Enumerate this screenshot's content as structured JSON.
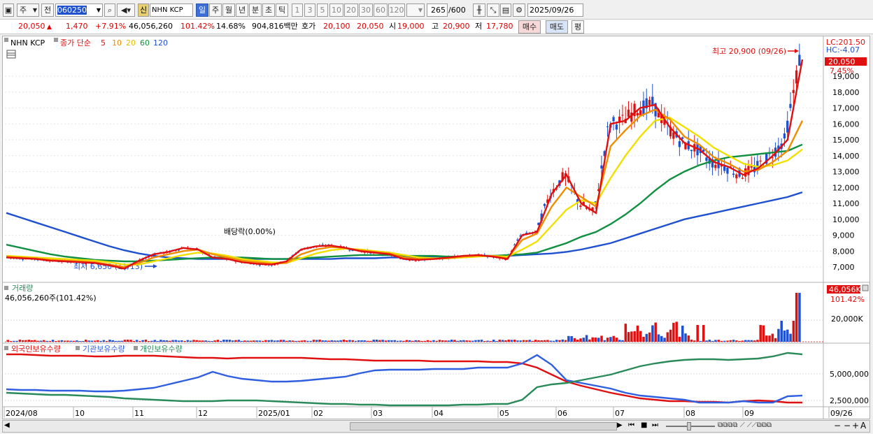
{
  "toolbar": {
    "market_type": "주",
    "prev_label": "전",
    "stock_code": "060250",
    "new_badge": "신",
    "stock_name": "NHN KCP",
    "periods": [
      "일",
      "주",
      "월",
      "년",
      "분",
      "초",
      "틱"
    ],
    "active_period": "일",
    "intervals": [
      "1",
      "3",
      "5",
      "10",
      "20",
      "30",
      "60",
      "120"
    ],
    "count_value": "265",
    "count_total": "/600",
    "date": "2025/09/26"
  },
  "quote": {
    "price": "20,050",
    "arrow": "▲",
    "change": "1,470",
    "change_pct": "+7.91%",
    "volume": "46,056,260",
    "volume_ratio": "101.42%",
    "turnover": "14.68%",
    "amount": "904,816백만",
    "bid_label": "호가",
    "bid1": "20,100",
    "bid2": "20,050",
    "open_label": "시",
    "open": "19,000",
    "high_label": "고",
    "high": "20,900",
    "low_label": "저",
    "low": "17,780",
    "buy_label": "매수",
    "sell_label": "매도",
    "eval_label": "평"
  },
  "price_panel": {
    "legend_name": "NHN KCP",
    "legend_ma_label": "종가 단순",
    "ma_periods": [
      "5",
      "10",
      "20",
      "60",
      "120"
    ],
    "ma_colors": [
      "#e01010",
      "#f08c00",
      "#f0e000",
      "#109040",
      "#1e50d0"
    ],
    "lc_label": "LC:201.50",
    "hc_label": "HC:-4.07",
    "current_price_badge": "20,050",
    "current_pct_badge": "7.45%",
    "high_marker": "최고 20,900 (09/26)",
    "low_marker": "최저 6,650 (11/13)",
    "dividend_marker": "배당락(0.00%)"
  },
  "volume_panel": {
    "title": "거래량",
    "value_text": "46,056,260주(101.42%)",
    "badge_value": "46,056K",
    "badge_pct": "101.42%"
  },
  "holdings_panel": {
    "legend": [
      "외국인보유수량",
      "기관보유수량",
      "개인보유수량"
    ],
    "colors": [
      "#e01010",
      "#2f5fe0",
      "#2a8a5a"
    ]
  },
  "x_labels": [
    "2024/08",
    "10",
    "11",
    "12",
    "2025/01",
    "02",
    "03",
    "04",
    "05",
    "06",
    "07",
    "08",
    "09",
    "09/26"
  ],
  "chart_data": {
    "type": "line",
    "price_axis": {
      "ticks": [
        "19,000",
        "18,000",
        "17,000",
        "16,000",
        "15,000",
        "14,000",
        "13,000",
        "12,000",
        "11,000",
        "10,000",
        "9,000",
        "8,000",
        "7,000"
      ],
      "ylim": [
        6000,
        21000
      ]
    },
    "volume_axis": {
      "ticks": [
        "20,000K"
      ]
    },
    "holdings_axis": {
      "ticks": [
        "5,000,000",
        "2,500,000"
      ]
    },
    "series": [
      {
        "name": "5",
        "values": [
          7600,
          7550,
          7500,
          7400,
          7350,
          7300,
          7250,
          7100,
          6900,
          7400,
          7800,
          7950,
          8200,
          8100,
          7600,
          7500,
          7300,
          7200,
          7150,
          7350,
          8100,
          8300,
          8350,
          8200,
          8000,
          7900,
          7800,
          7500,
          7450,
          7500,
          7600,
          7700,
          7750,
          7650,
          7500,
          9000,
          9200,
          11600,
          12800,
          11000,
          10400,
          16000,
          16200,
          17000,
          17200,
          15800,
          14800,
          14400,
          13600,
          13300,
          12800,
          13200,
          14000,
          15000,
          20050
        ]
      },
      {
        "name": "10",
        "values": [
          7650,
          7600,
          7550,
          7450,
          7400,
          7350,
          7300,
          7150,
          7000,
          7250,
          7600,
          7800,
          8000,
          8100,
          7800,
          7600,
          7400,
          7300,
          7200,
          7250,
          7800,
          8100,
          8250,
          8200,
          8050,
          7950,
          7850,
          7600,
          7500,
          7500,
          7550,
          7650,
          7700,
          7700,
          7550,
          8700,
          9100,
          10800,
          12000,
          11400,
          10800,
          14600,
          15600,
          16500,
          16900,
          16300,
          15200,
          14700,
          13900,
          13500,
          13000,
          13100,
          13600,
          14300,
          16200
        ]
      },
      {
        "name": "20",
        "values": [
          7700,
          7650,
          7600,
          7550,
          7500,
          7450,
          7400,
          7300,
          7150,
          7150,
          7350,
          7550,
          7750,
          7900,
          7850,
          7700,
          7500,
          7400,
          7300,
          7250,
          7550,
          7850,
          8050,
          8150,
          8100,
          8000,
          7900,
          7750,
          7600,
          7550,
          7550,
          7600,
          7650,
          7700,
          7650,
          8100,
          8600,
          9600,
          10600,
          11200,
          11000,
          12600,
          14000,
          15200,
          16200,
          16400,
          15800,
          15200,
          14500,
          14000,
          13500,
          13300,
          13400,
          13700,
          14400
        ]
      },
      {
        "name": "60",
        "values": [
          8400,
          8200,
          8000,
          7800,
          7650,
          7550,
          7450,
          7400,
          7350,
          7350,
          7400,
          7450,
          7500,
          7550,
          7600,
          7600,
          7600,
          7550,
          7500,
          7500,
          7550,
          7600,
          7650,
          7700,
          7750,
          7750,
          7750,
          7700,
          7700,
          7700,
          7650,
          7650,
          7700,
          7700,
          7750,
          7800,
          7900,
          8200,
          8500,
          8900,
          9200,
          9700,
          10300,
          11000,
          11800,
          12500,
          13000,
          13400,
          13700,
          13900,
          14000,
          14100,
          14200,
          14300,
          14700
        ]
      },
      {
        "name": "120",
        "values": [
          10400,
          10100,
          9800,
          9500,
          9200,
          8900,
          8600,
          8300,
          8050,
          7850,
          7700,
          7600,
          7550,
          7500,
          7500,
          7500,
          7500,
          7500,
          7500,
          7500,
          7500,
          7500,
          7500,
          7550,
          7550,
          7550,
          7600,
          7600,
          7600,
          7650,
          7650,
          7650,
          7700,
          7700,
          7700,
          7750,
          7800,
          7850,
          7950,
          8100,
          8300,
          8500,
          8800,
          9100,
          9400,
          9700,
          10000,
          10200,
          10400,
          10600,
          10800,
          11000,
          11200,
          11400,
          11700
        ]
      }
    ]
  }
}
